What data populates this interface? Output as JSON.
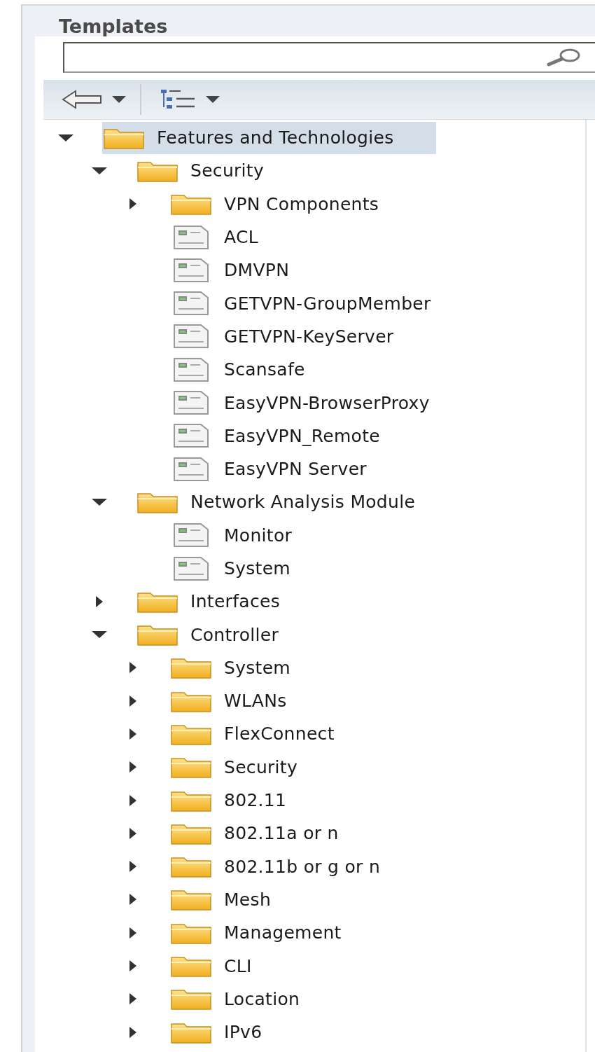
{
  "panel": {
    "title": "Templates"
  },
  "toolbar": {
    "buttons": [
      {
        "kind": "back"
      },
      {
        "kind": "tree"
      }
    ]
  },
  "tree": [
    {
      "label": "Features and Technologies",
      "kind": "folder",
      "expanded": true,
      "selected": true,
      "children": [
        {
          "label": "Security",
          "kind": "folder",
          "expanded": true,
          "selected": false,
          "children": [
            {
              "label": "VPN Components",
              "kind": "folder",
              "expanded": false,
              "selected": false
            },
            {
              "label": "ACL",
              "kind": "template",
              "selected": false
            },
            {
              "label": "DMVPN",
              "kind": "template",
              "selected": false
            },
            {
              "label": "GETVPN-GroupMember",
              "kind": "template",
              "selected": false
            },
            {
              "label": "GETVPN-KeyServer",
              "kind": "template",
              "selected": false
            },
            {
              "label": "Scansafe",
              "kind": "template",
              "selected": false
            },
            {
              "label": "EasyVPN-BrowserProxy",
              "kind": "template",
              "selected": false
            },
            {
              "label": "EasyVPN_Remote",
              "kind": "template",
              "selected": false
            },
            {
              "label": "EasyVPN Server",
              "kind": "template",
              "selected": false
            }
          ]
        },
        {
          "label": "Network Analysis Module",
          "kind": "folder",
          "expanded": true,
          "selected": false,
          "children": [
            {
              "label": "Monitor",
              "kind": "template",
              "selected": false
            },
            {
              "label": "System",
              "kind": "template",
              "selected": false
            }
          ]
        },
        {
          "label": "Interfaces",
          "kind": "folder",
          "expanded": false,
          "selected": false
        },
        {
          "label": "Controller",
          "kind": "folder",
          "expanded": true,
          "selected": false,
          "children": [
            {
              "label": "System",
              "kind": "folder",
              "expanded": false,
              "selected": false
            },
            {
              "label": "WLANs",
              "kind": "folder",
              "expanded": false,
              "selected": false
            },
            {
              "label": "FlexConnect",
              "kind": "folder",
              "expanded": false,
              "selected": false
            },
            {
              "label": "Security",
              "kind": "folder",
              "expanded": false,
              "selected": false
            },
            {
              "label": "802.11",
              "kind": "folder",
              "expanded": false,
              "selected": false
            },
            {
              "label": "802.11a or n",
              "kind": "folder",
              "expanded": false,
              "selected": false
            },
            {
              "label": "802.11b or g or n",
              "kind": "folder",
              "expanded": false,
              "selected": false
            },
            {
              "label": "Mesh",
              "kind": "folder",
              "expanded": false,
              "selected": false
            },
            {
              "label": "Management",
              "kind": "folder",
              "expanded": false,
              "selected": false
            },
            {
              "label": "CLI",
              "kind": "folder",
              "expanded": false,
              "selected": false
            },
            {
              "label": "Location",
              "kind": "folder",
              "expanded": false,
              "selected": false
            },
            {
              "label": "IPv6",
              "kind": "folder",
              "expanded": false,
              "selected": false
            }
          ]
        }
      ]
    }
  ]
}
